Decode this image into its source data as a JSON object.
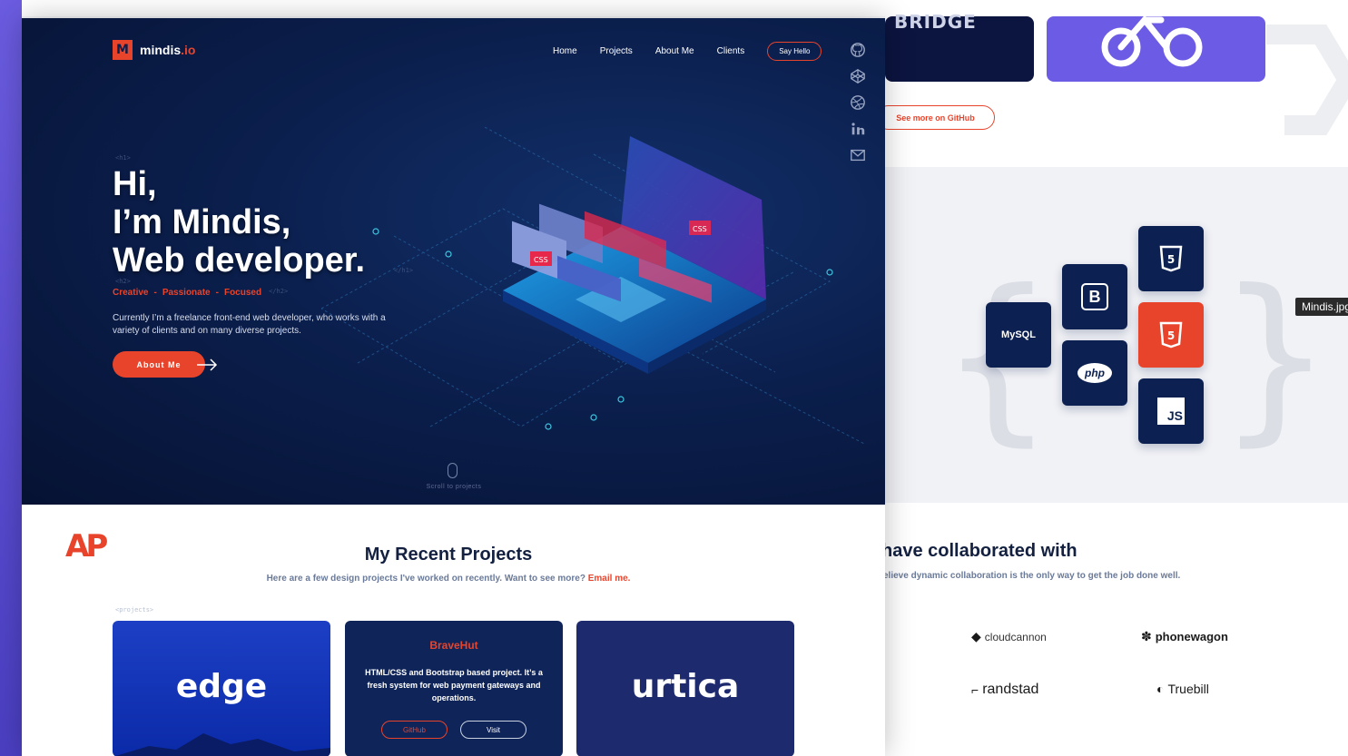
{
  "window": {
    "tooltip": "Mindis.jpg"
  },
  "brand": {
    "name": "mindis",
    "tld": ".io",
    "mark": "M",
    "accent": "#e8442c",
    "navy": "#0b1f4d"
  },
  "nav": {
    "links": [
      "Home",
      "Projects",
      "About Me",
      "Clients"
    ],
    "cta": "Say Hello"
  },
  "social": [
    "github-icon",
    "codepen-icon",
    "dribbble-icon",
    "linkedin-icon",
    "mail-icon"
  ],
  "hero": {
    "tag_open": "<h1>",
    "line1": "Hi,",
    "line2": "I’m Mindis,",
    "line3": "Web developer.",
    "tag_close": "</h1>",
    "h2_open": "<h2>",
    "h2_close": "</h2>",
    "tags": [
      "Creative",
      "-",
      "Passionate",
      "-",
      "Focused"
    ],
    "description": "Currently I’m a freelance front-end web developer,  who works with a variety of clients and on many diverse projects.",
    "button": "About Me",
    "scroll_label": "Scroll to projects",
    "css_badge_1": "CSS",
    "css_badge_2": "CSS"
  },
  "projects": {
    "logo": "AP",
    "title": "My Recent Projects",
    "subtitle": "Here are a few design projects I've worked on recently. Want to see more?",
    "email_link": "Email me.",
    "tag": "<projects>",
    "cards": [
      {
        "name": "edge"
      },
      {
        "name": "BraveHut",
        "description": "HTML/CSS and Bootstrap based project. It’s a fresh  system for web payment gateways and operations.",
        "github": "GitHub",
        "visit": "Visit"
      },
      {
        "name": "urtica"
      }
    ]
  },
  "background_page": {
    "bridge_label": "BRIDGE",
    "see_more": "See more on GitHub",
    "skills": [
      "MySQL",
      "B",
      "php",
      "5",
      "5",
      "JS"
    ],
    "collab_title": "have collaborated with",
    "collab_subtitle": "elieve dynamic collaboration is the only way to get the job done well.",
    "clients": [
      "cloudcannon",
      "phonewagon",
      "randstad",
      "Truebill"
    ]
  }
}
